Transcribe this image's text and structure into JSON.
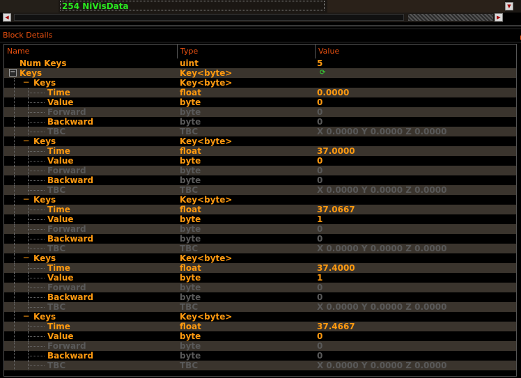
{
  "node_list": {
    "selected_label": "254 NiVisData"
  },
  "panel": {
    "title": "Block Details"
  },
  "columns": {
    "name": "Name",
    "type": "Type",
    "value": "Value"
  },
  "rows": [
    {
      "name": "Num Keys",
      "type": "uint",
      "value": "5",
      "level": 0,
      "disabled": false,
      "exp": ""
    },
    {
      "name": "Keys",
      "type": "Key<byte>",
      "value": "",
      "level": 0,
      "disabled": false,
      "exp": "box",
      "spinner": true
    },
    {
      "name": "Keys",
      "type": "Key<byte>",
      "value": "",
      "level": 1,
      "disabled": false,
      "exp": "minus"
    },
    {
      "name": "Time",
      "type": "float",
      "value": "0.0000",
      "level": 2,
      "disabled": false
    },
    {
      "name": "Value",
      "type": "byte",
      "value": "0",
      "level": 2,
      "disabled": false
    },
    {
      "name": "Forward",
      "type": "byte",
      "value": "0",
      "level": 2,
      "disabled": true
    },
    {
      "name": "Backward",
      "type": "byte",
      "value": "0",
      "level": 2,
      "disabled": false,
      "type_on": false,
      "value_on": false
    },
    {
      "name": "TBC",
      "type": "TBC",
      "value": "X 0.0000 Y 0.0000 Z 0.0000",
      "level": 2,
      "disabled": true
    },
    {
      "name": "Keys",
      "type": "Key<byte>",
      "value": "",
      "level": 1,
      "disabled": false,
      "exp": "minus"
    },
    {
      "name": "Time",
      "type": "float",
      "value": "37.0000",
      "level": 2,
      "disabled": false
    },
    {
      "name": "Value",
      "type": "byte",
      "value": "0",
      "level": 2,
      "disabled": false
    },
    {
      "name": "Forward",
      "type": "byte",
      "value": "0",
      "level": 2,
      "disabled": true
    },
    {
      "name": "Backward",
      "type": "byte",
      "value": "0",
      "level": 2,
      "disabled": false,
      "type_on": false,
      "value_on": false
    },
    {
      "name": "TBC",
      "type": "TBC",
      "value": "X 0.0000 Y 0.0000 Z 0.0000",
      "level": 2,
      "disabled": true
    },
    {
      "name": "Keys",
      "type": "Key<byte>",
      "value": "",
      "level": 1,
      "disabled": false,
      "exp": "minus"
    },
    {
      "name": "Time",
      "type": "float",
      "value": "37.0667",
      "level": 2,
      "disabled": false
    },
    {
      "name": "Value",
      "type": "byte",
      "value": "1",
      "level": 2,
      "disabled": false
    },
    {
      "name": "Forward",
      "type": "byte",
      "value": "0",
      "level": 2,
      "disabled": true
    },
    {
      "name": "Backward",
      "type": "byte",
      "value": "0",
      "level": 2,
      "disabled": false,
      "type_on": false,
      "value_on": false
    },
    {
      "name": "TBC",
      "type": "TBC",
      "value": "X 0.0000 Y 0.0000 Z 0.0000",
      "level": 2,
      "disabled": true
    },
    {
      "name": "Keys",
      "type": "Key<byte>",
      "value": "",
      "level": 1,
      "disabled": false,
      "exp": "minus"
    },
    {
      "name": "Time",
      "type": "float",
      "value": "37.4000",
      "level": 2,
      "disabled": false
    },
    {
      "name": "Value",
      "type": "byte",
      "value": "1",
      "level": 2,
      "disabled": false
    },
    {
      "name": "Forward",
      "type": "byte",
      "value": "0",
      "level": 2,
      "disabled": true
    },
    {
      "name": "Backward",
      "type": "byte",
      "value": "0",
      "level": 2,
      "disabled": false,
      "type_on": false,
      "value_on": false
    },
    {
      "name": "TBC",
      "type": "TBC",
      "value": "X 0.0000 Y 0.0000 Z 0.0000",
      "level": 2,
      "disabled": true
    },
    {
      "name": "Keys",
      "type": "Key<byte>",
      "value": "",
      "level": 1,
      "disabled": false,
      "exp": "minus"
    },
    {
      "name": "Time",
      "type": "float",
      "value": "37.4667",
      "level": 2,
      "disabled": false
    },
    {
      "name": "Value",
      "type": "byte",
      "value": "0",
      "level": 2,
      "disabled": false
    },
    {
      "name": "Forward",
      "type": "byte",
      "value": "0",
      "level": 2,
      "disabled": true
    },
    {
      "name": "Backward",
      "type": "byte",
      "value": "0",
      "level": 2,
      "disabled": false,
      "type_on": false,
      "value_on": false
    },
    {
      "name": "TBC",
      "type": "TBC",
      "value": "X 0.0000 Y 0.0000 Z 0.0000",
      "level": 2,
      "disabled": true
    }
  ],
  "colors": {
    "text": "#ff9a10",
    "disabled_text": "#595959",
    "header_text": "#e85010",
    "node_label": "#29e81f",
    "row_alt": "#3a342d"
  }
}
